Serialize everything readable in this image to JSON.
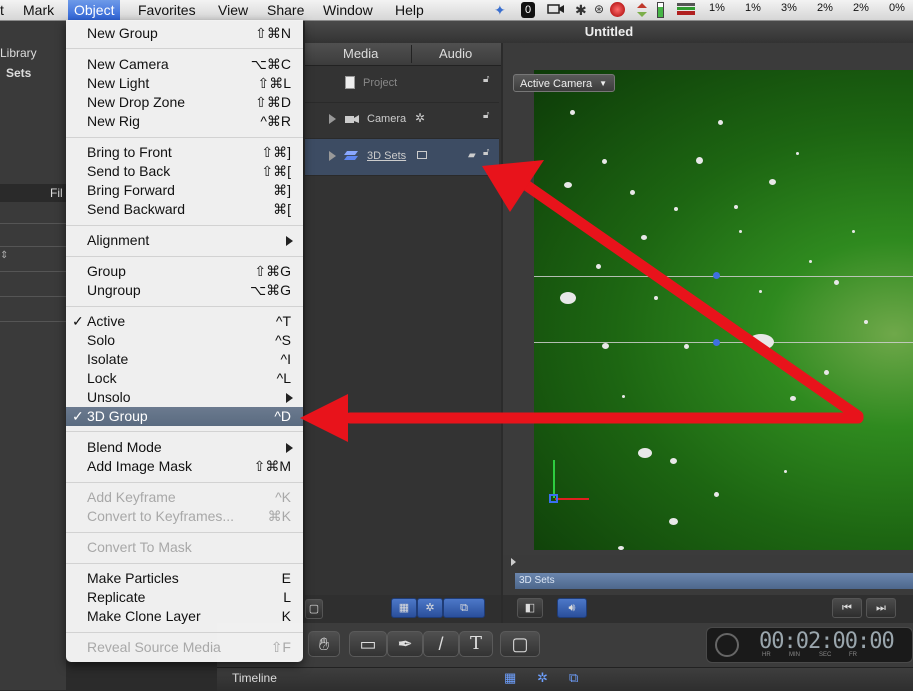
{
  "menubar": {
    "items": [
      "t",
      "Mark",
      "Object",
      "Favorites",
      "View",
      "Share",
      "Window",
      "Help"
    ],
    "status_text": [
      "1%",
      "1%",
      "3%",
      "2%",
      "2%",
      "0%"
    ],
    "status_icon_o": "0"
  },
  "window": {
    "title": "Untitled"
  },
  "left_pane": {
    "library_label": "Library",
    "sets_label": "Sets",
    "fil_label": "Fil"
  },
  "layers_tabs": [
    "Media",
    "Audio"
  ],
  "layers": [
    {
      "name": "Project"
    },
    {
      "name": "Camera"
    },
    {
      "name": "3D Sets"
    }
  ],
  "canvas": {
    "camera_label": "Active Camera",
    "timeline_track_label": "3D Sets"
  },
  "timecode": {
    "value": "00:02:00:00",
    "units": [
      "HR",
      "MIN",
      "SEC",
      "FR"
    ]
  },
  "timeline_tab": {
    "label": "Timeline"
  },
  "toolbar": {
    "text_tool": "T"
  },
  "menu": {
    "items": [
      {
        "label": "New Group",
        "key": "⇧⌘N"
      },
      {
        "label": "New Camera",
        "key": "⌥⌘C"
      },
      {
        "label": "New Light",
        "key": "⇧⌘L"
      },
      {
        "label": "New Drop Zone",
        "key": "⇧⌘D"
      },
      {
        "label": "New Rig",
        "key": "^⌘R"
      },
      {
        "label": "Bring to Front",
        "key": "⇧⌘]"
      },
      {
        "label": "Send to Back",
        "key": "⇧⌘["
      },
      {
        "label": "Bring Forward",
        "key": "⌘]"
      },
      {
        "label": "Send Backward",
        "key": "⌘["
      },
      {
        "label": "Alignment",
        "key": ""
      },
      {
        "label": "Group",
        "key": "⇧⌘G"
      },
      {
        "label": "Ungroup",
        "key": "⌥⌘G"
      },
      {
        "label": "Active",
        "key": "^T"
      },
      {
        "label": "Solo",
        "key": "^S"
      },
      {
        "label": "Isolate",
        "key": "^I"
      },
      {
        "label": "Lock",
        "key": "^L"
      },
      {
        "label": "Unsolo",
        "key": ""
      },
      {
        "label": "3D Group",
        "key": "^D"
      },
      {
        "label": "Blend Mode",
        "key": ""
      },
      {
        "label": "Add Image Mask",
        "key": "⇧⌘M"
      },
      {
        "label": "Add Keyframe",
        "key": "^K"
      },
      {
        "label": "Convert to Keyframes...",
        "key": "⌘K"
      },
      {
        "label": "Convert To Mask",
        "key": ""
      },
      {
        "label": "Make Particles",
        "key": "E"
      },
      {
        "label": "Replicate",
        "key": "L"
      },
      {
        "label": "Make Clone Layer",
        "key": "K"
      },
      {
        "label": "Reveal Source Media",
        "key": "⇧F"
      }
    ],
    "checkmark": "✓"
  }
}
